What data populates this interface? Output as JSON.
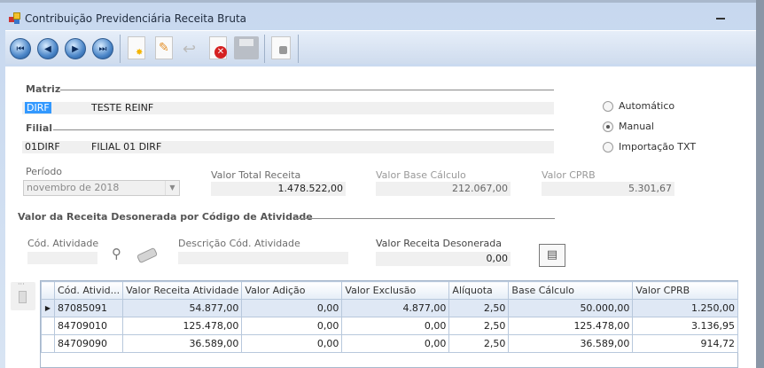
{
  "window": {
    "title": "Contribuição Previdenciária Receita Bruta"
  },
  "toolbar": {
    "buttons": [
      "first-icon",
      "previous-icon",
      "next-icon",
      "last-icon",
      "new-icon",
      "edit-icon",
      "undo-icon",
      "delete-icon",
      "save-icon",
      "lock-icon"
    ]
  },
  "matriz": {
    "label": "Matriz",
    "code": "DIRF",
    "name": "TESTE REINF"
  },
  "filial": {
    "label": "Filial",
    "code": "01DIRF",
    "name": "FILIAL 01 DIRF"
  },
  "mode": {
    "options": [
      "Automático",
      "Manual",
      "Importação TXT"
    ],
    "selected": "Manual"
  },
  "periodo": {
    "label": "Período",
    "value": "novembro de 2018"
  },
  "totals": {
    "receita_label": "Valor Total Receita",
    "receita": "1.478.522,00",
    "base_label": "Valor Base Cálculo",
    "base": "212.067,00",
    "cprb_label": "Valor CPRB",
    "cprb": "5.301,67"
  },
  "section": {
    "title": "Valor da Receita Desonerada por Código de Atividade",
    "cod_label": "Cód. Atividade",
    "cod": "",
    "desc_label": "Descrição Cód. Atividade",
    "desc": "",
    "valor_label": "Valor Receita Desonerada",
    "valor": "0,00"
  },
  "grid": {
    "columns": [
      "Cód. Ativid...",
      "Valor Receita Atividade",
      "Valor Adição",
      "Valor Exclusão",
      "Alíquota",
      "Base Cálculo",
      "Valor CPRB"
    ],
    "rows": [
      [
        "87085091",
        "54.877,00",
        "0,00",
        "4.877,00",
        "2,50",
        "50.000,00",
        "1.250,00"
      ],
      [
        "84709010",
        "125.478,00",
        "0,00",
        "0,00",
        "2,50",
        "125.478,00",
        "3.136,95"
      ],
      [
        "84709090",
        "36.589,00",
        "0,00",
        "0,00",
        "2,50",
        "36.589,00",
        "914,72"
      ]
    ]
  }
}
